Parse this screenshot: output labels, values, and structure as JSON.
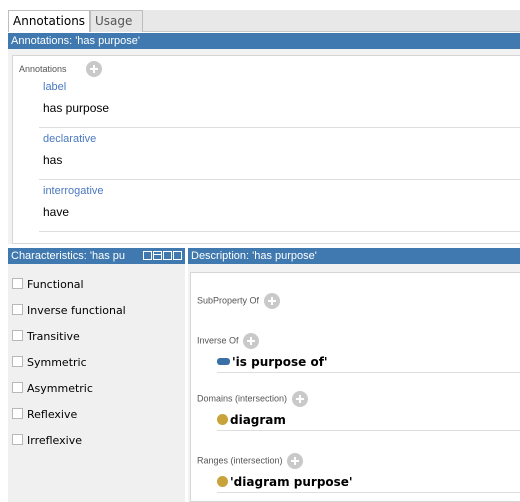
{
  "tabs": [
    {
      "label": "Annotations"
    },
    {
      "label": "Usage"
    }
  ],
  "annotations_header": "Annotations: 'has purpose'",
  "annotations": {
    "title": "Annotations",
    "items": [
      {
        "key": "label",
        "value": "has purpose"
      },
      {
        "key": "declarative",
        "value": "has"
      },
      {
        "key": "interrogative",
        "value": "have"
      }
    ]
  },
  "characteristics": {
    "header": "Characteristics: 'has pu",
    "items": [
      {
        "label": "Functional",
        "checked": false
      },
      {
        "label": "Inverse functional",
        "checked": false
      },
      {
        "label": "Transitive",
        "checked": false
      },
      {
        "label": "Symmetric",
        "checked": false
      },
      {
        "label": "Asymmetric",
        "checked": false
      },
      {
        "label": "Reflexive",
        "checked": false
      },
      {
        "label": "Irreflexive",
        "checked": false
      }
    ]
  },
  "description": {
    "header": "Description: 'has purpose'",
    "subproperty_title": "SubProperty Of",
    "inverse_title": "Inverse Of",
    "inverse_value": "'is purpose of'",
    "domains_title": "Domains (intersection)",
    "domains_value": "diagram",
    "ranges_title": "Ranges (intersection)",
    "ranges_value": "'diagram purpose'"
  },
  "colors": {
    "header_blue": "#3f79b0",
    "annotation_key": "#4a78c0",
    "class_dot": "#c8a23a",
    "property_pill": "#3a6fa6"
  }
}
